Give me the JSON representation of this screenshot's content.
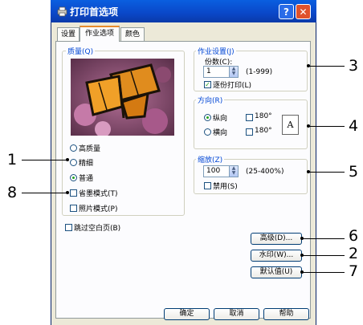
{
  "window": {
    "title": "打印首选项",
    "help_btn": "?",
    "close_btn": "✕"
  },
  "tabs": [
    {
      "label": "设置"
    },
    {
      "label": "作业选项"
    },
    {
      "label": "颜色"
    }
  ],
  "quality": {
    "legend": "质量(Q)",
    "options": [
      {
        "label": "高质量",
        "selected": false
      },
      {
        "label": "精细",
        "selected": false
      },
      {
        "label": "普通",
        "selected": true
      }
    ],
    "toner_save": {
      "label": "省墨模式(T)",
      "checked": false
    },
    "photo_mode": {
      "label": "照片模式(P)",
      "checked": false
    }
  },
  "skip_blank": {
    "label": "跳过空白页(B)",
    "checked": false
  },
  "job_settings": {
    "legend": "作业设置(J)",
    "copies_label": "份数(C):",
    "copies_value": "1",
    "copies_range": "(1-999)",
    "collate": {
      "label": "逐份打印(L)",
      "checked": true
    }
  },
  "orientation": {
    "legend": "方向(R)",
    "portrait": {
      "label": "纵向",
      "selected": true
    },
    "landscape": {
      "label": "横向",
      "selected": false
    },
    "rotate1": {
      "label": "180°",
      "checked": false
    },
    "rotate2": {
      "label": "180°",
      "checked": false
    },
    "preview_glyph": "A"
  },
  "zoom": {
    "legend": "缩放(Z)",
    "value": "100",
    "range": "(25-400%)",
    "disable": {
      "label": "禁用(S)",
      "checked": false
    }
  },
  "buttons": {
    "advanced": "高级(D)...",
    "watermark": "水印(W)...",
    "default": "默认值(U)",
    "ok": "确定",
    "cancel": "取消",
    "help": "帮助"
  },
  "callouts": {
    "c1": "1",
    "c2": "2",
    "c3": "3",
    "c4": "4",
    "c5": "5",
    "c6": "6",
    "c7": "7",
    "c8": "8"
  },
  "colors": {
    "titlebar": "#0a47c8",
    "tab_accent": "#e68b2c",
    "group_title": "#0046d5",
    "check": "#21a121"
  }
}
